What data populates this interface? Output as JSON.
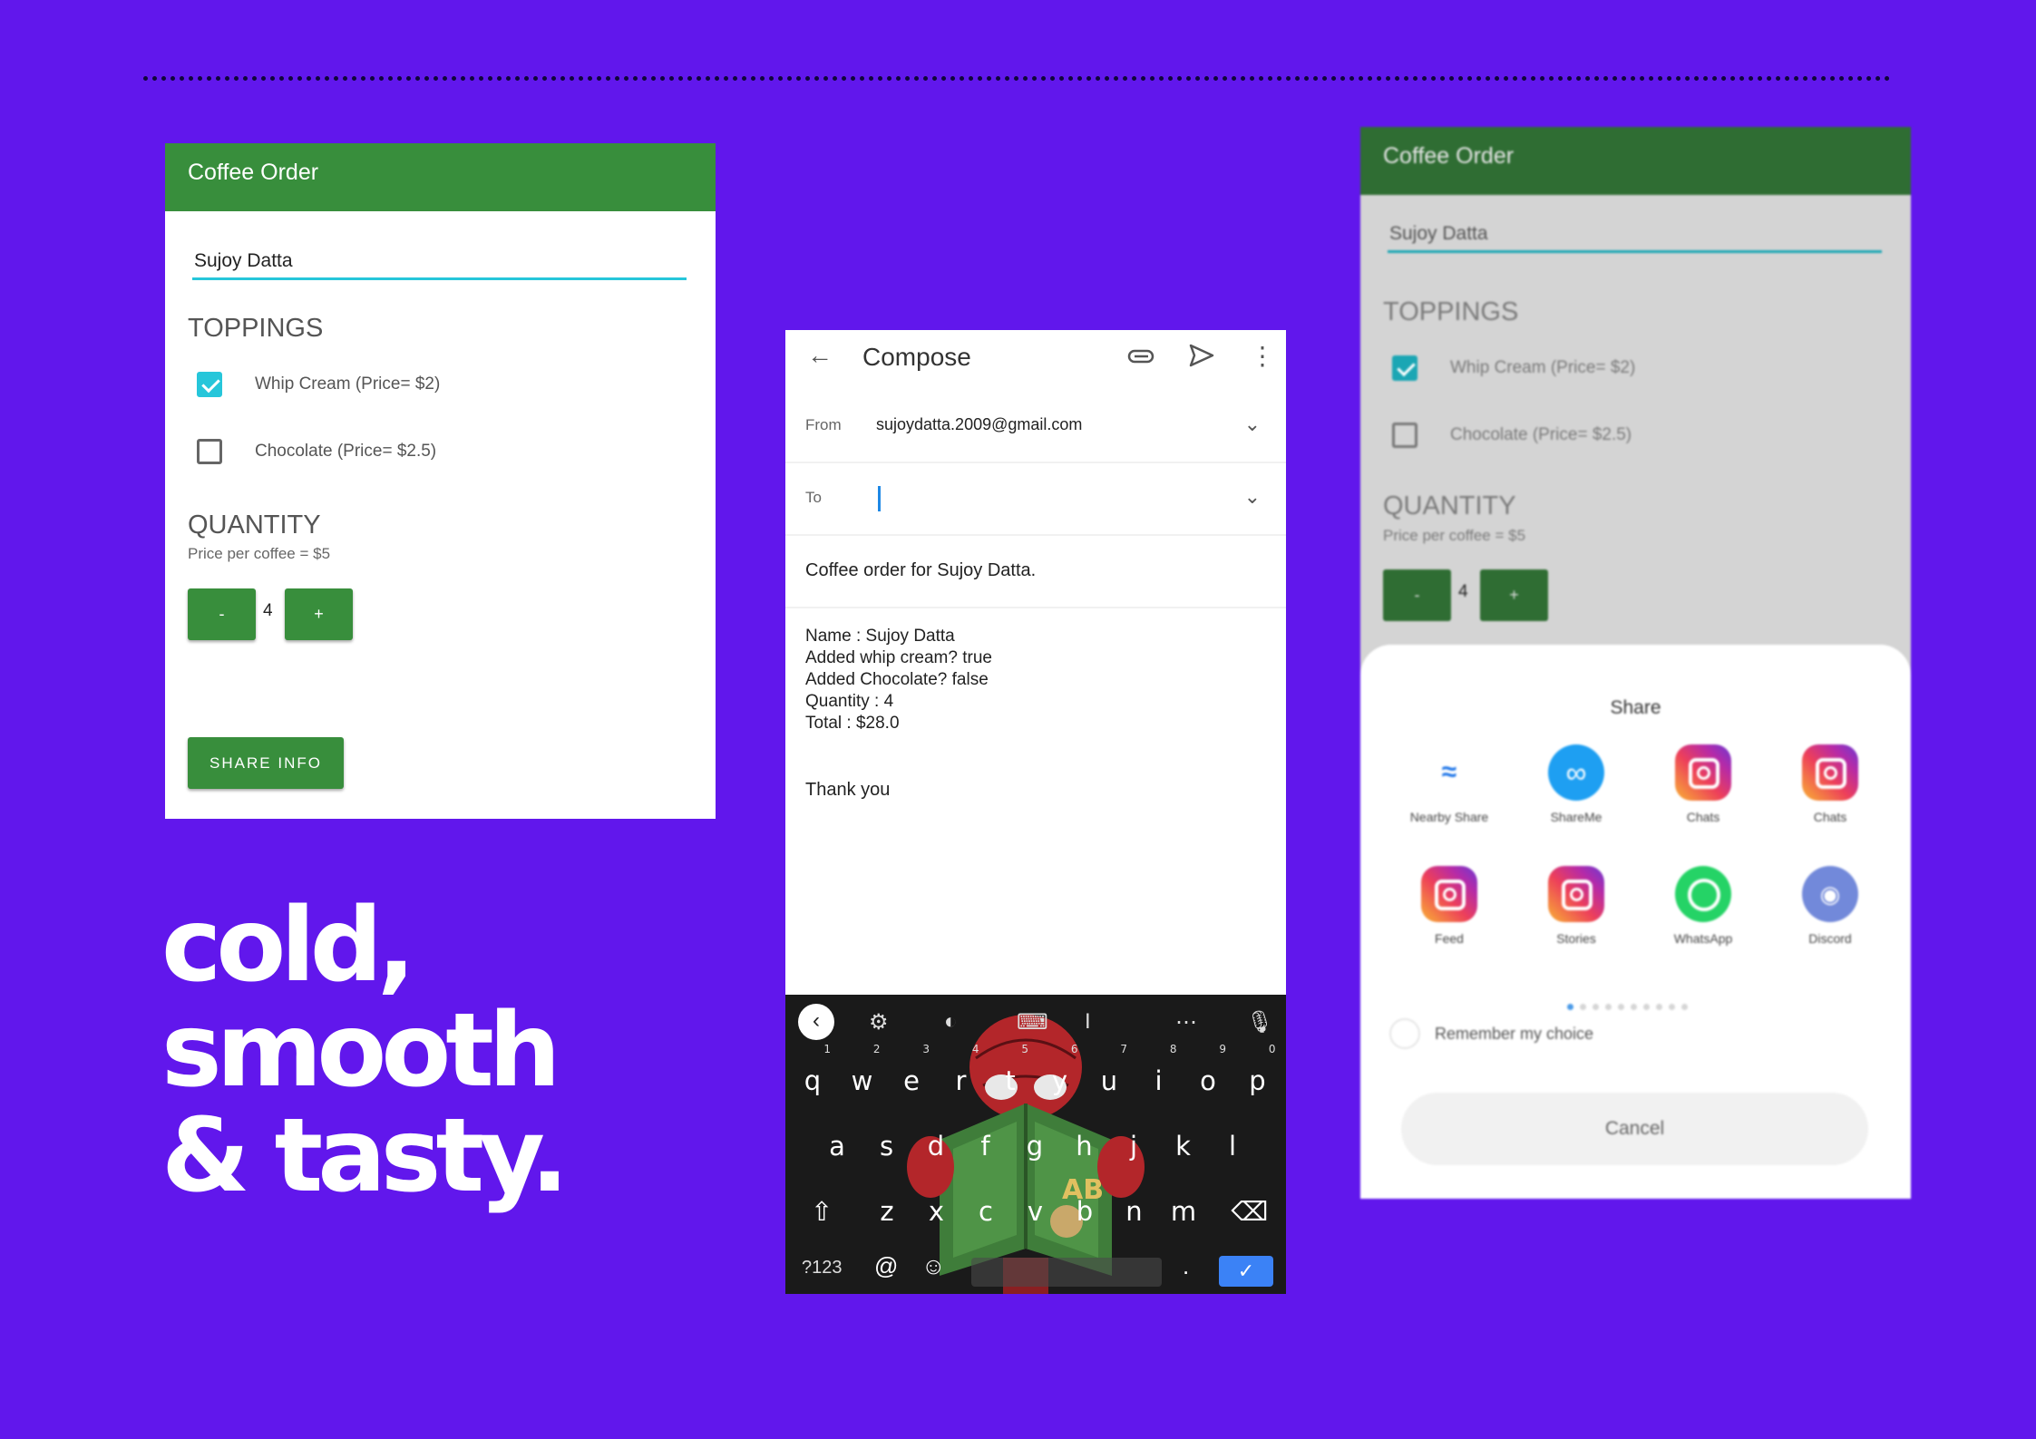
{
  "colors": {
    "background": "#6117ec",
    "appbar_green": "#388e3c",
    "accent_teal": "#26c6da",
    "keyboard_bg": "#1a1a1a",
    "enter_blue": "#3b82f6"
  },
  "tagline": [
    "cold,",
    "smooth",
    "& tasty."
  ],
  "order_screen": {
    "app_title": "Coffee Order",
    "name_value": "Sujoy Datta",
    "toppings_heading": "TOPPINGS",
    "toppings": [
      {
        "label": "Whip Cream (Price= $2)",
        "checked": true
      },
      {
        "label": "Chocolate (Price= $2.5)",
        "checked": false
      }
    ],
    "quantity_heading": "QUANTITY",
    "price_per_coffee": "Price per coffee = $5",
    "decrement_label": "-",
    "quantity": "4",
    "increment_label": "+",
    "share_button_label": "SHARE INFO"
  },
  "compose_screen": {
    "title": "Compose",
    "icons": [
      "back-arrow-icon",
      "attachment-icon",
      "send-icon",
      "more-vert-icon"
    ],
    "from_label": "From",
    "from_value": "sujoydatta.2009@gmail.com",
    "to_label": "To",
    "to_value": "",
    "subject": "Coffee order for Sujoy Datta.",
    "body_lines": [
      "Name : Sujoy Datta",
      "Added whip cream? true",
      "Added Chocolate? false",
      "Quantity : 4",
      "Total : $28.0"
    ],
    "closing": "Thank you",
    "keyboard": {
      "row1": [
        {
          "k": "q",
          "n": "1"
        },
        {
          "k": "w",
          "n": "2"
        },
        {
          "k": "e",
          "n": "3"
        },
        {
          "k": "r",
          "n": "4"
        },
        {
          "k": "t",
          "n": "5"
        },
        {
          "k": "y",
          "n": "6"
        },
        {
          "k": "u",
          "n": "7"
        },
        {
          "k": "i",
          "n": "8"
        },
        {
          "k": "o",
          "n": "9"
        },
        {
          "k": "p",
          "n": "0"
        }
      ],
      "row2": [
        "a",
        "s",
        "d",
        "f",
        "g",
        "h",
        "j",
        "k",
        "l"
      ],
      "row3": [
        "z",
        "x",
        "c",
        "v",
        "b",
        "n",
        "m"
      ],
      "symbols_key": "?123",
      "at_key": "@",
      "period_key": "."
    }
  },
  "share_screen": {
    "app_title": "Coffee Order",
    "name_value": "Sujoy Datta",
    "toppings_heading": "TOPPINGS",
    "toppings": [
      {
        "label": "Whip Cream (Price= $2)",
        "checked": true
      },
      {
        "label": "Chocolate (Price= $2.5)",
        "checked": false
      }
    ],
    "quantity_heading": "QUANTITY",
    "price_per_coffee": "Price per coffee = $5",
    "decrement_label": "-",
    "quantity": "4",
    "increment_label": "+",
    "sheet_title": "Share",
    "targets": [
      {
        "label": "Nearby Share",
        "icon": "nearby-share-icon"
      },
      {
        "label": "ShareMe",
        "icon": "shareme-icon"
      },
      {
        "label": "Chats",
        "icon": "instagram-icon"
      },
      {
        "label": "Chats",
        "icon": "instagram-icon"
      },
      {
        "label": "Feed",
        "icon": "instagram-icon"
      },
      {
        "label": "Stories",
        "icon": "instagram-icon"
      },
      {
        "label": "WhatsApp",
        "icon": "whatsapp-icon"
      },
      {
        "label": "Discord",
        "icon": "discord-icon"
      }
    ],
    "page_indicator": {
      "pages": 10,
      "active": 1
    },
    "remember_label": "Remember my choice",
    "cancel_label": "Cancel"
  }
}
